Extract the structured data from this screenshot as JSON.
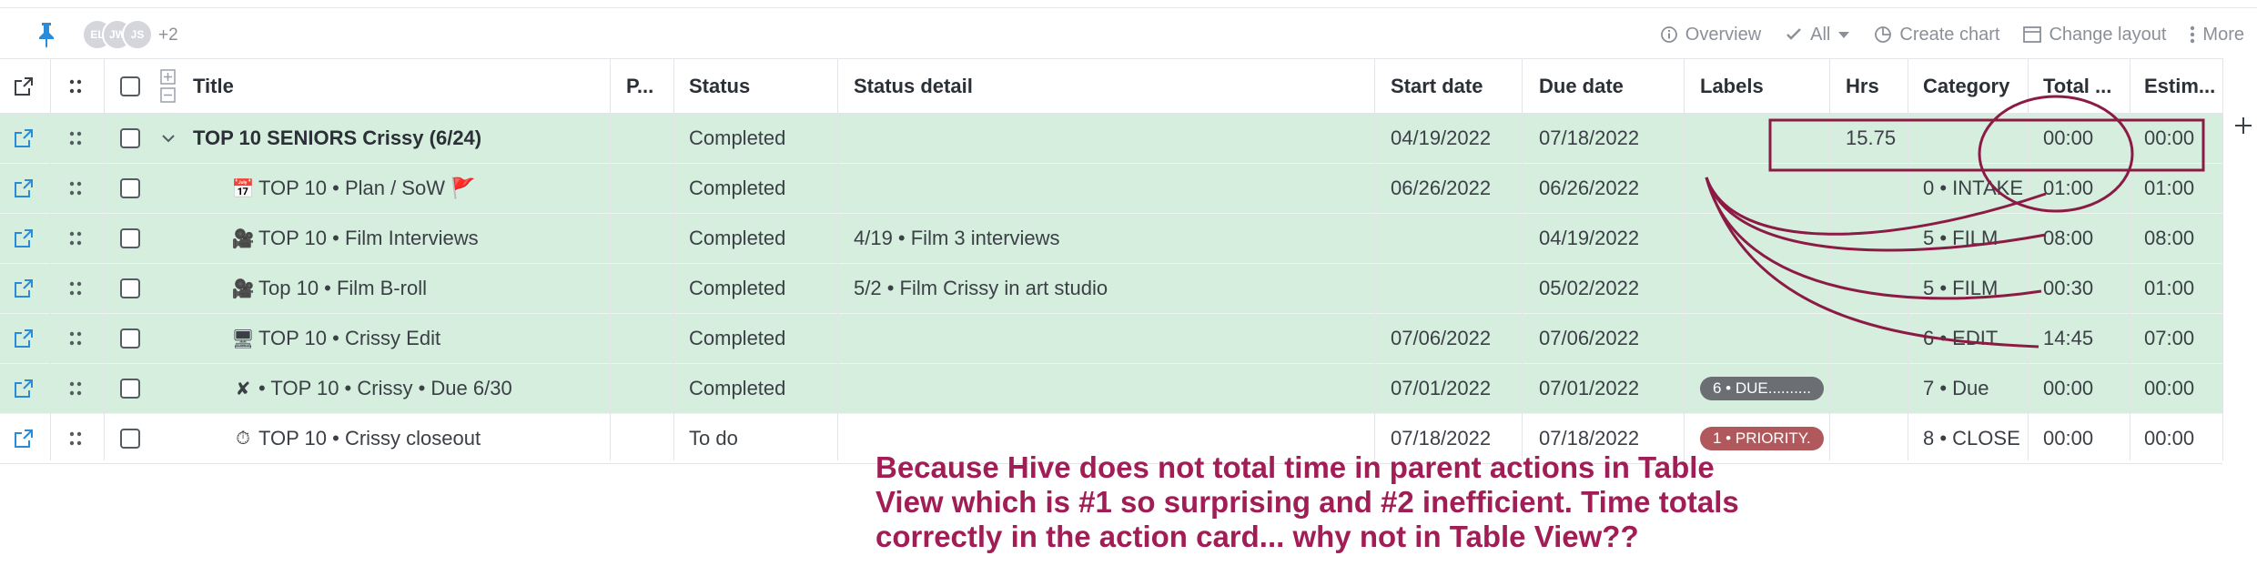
{
  "toolbar": {
    "avatars": [
      "EL",
      "JW",
      "JS"
    ],
    "avatar_more": "+2",
    "overview_label": "Overview",
    "filter_label": "All",
    "create_chart_label": "Create chart",
    "change_layout_label": "Change layout",
    "more_label": "More"
  },
  "table": {
    "columns": {
      "title": "Title",
      "p": "P...",
      "status": "Status",
      "status_detail": "Status detail",
      "start_date": "Start date",
      "due_date": "Due date",
      "labels": "Labels",
      "hrs": "Hrs",
      "category": "Category",
      "total": "Total ...",
      "estimate": "Estim..."
    },
    "rows": [
      {
        "title": "TOP 10 SENIORS Crissy (6/24)",
        "emoji": "",
        "status": "Completed",
        "status_detail": "",
        "start_date": "04/19/2022",
        "due_date": "07/18/2022",
        "label": "",
        "hrs": "15.75 h",
        "category": "",
        "total": "00:00",
        "estimate": "00:00"
      },
      {
        "title": "TOP 10 • Plan / SoW 🚩",
        "emoji": "📅",
        "status": "Completed",
        "status_detail": "",
        "start_date": "06/26/2022",
        "due_date": "06/26/2022",
        "label": "",
        "hrs": "",
        "category": "0 • INTAKE",
        "total": "01:00",
        "estimate": "01:00"
      },
      {
        "title": "TOP 10 • Film Interviews",
        "emoji": "🎥",
        "status": "Completed",
        "status_detail": "4/19 • Film 3 interviews",
        "start_date": "",
        "due_date": "04/19/2022",
        "label": "",
        "hrs": "",
        "category": "5 • FILM",
        "total": "08:00",
        "estimate": "08:00"
      },
      {
        "title": "Top 10 • Film B-roll",
        "emoji": "🎥",
        "status": "Completed",
        "status_detail": "5/2 • Film Crissy in art studio",
        "start_date": "",
        "due_date": "05/02/2022",
        "label": "",
        "hrs": "",
        "category": "5 • FILM",
        "total": "00:30",
        "estimate": "01:00"
      },
      {
        "title": "TOP 10 • Crissy Edit",
        "emoji": "🖥",
        "status": "Completed",
        "status_detail": "",
        "start_date": "07/06/2022",
        "due_date": "07/06/2022",
        "label": "",
        "hrs": "",
        "category": "6 • EDIT",
        "total": "14:45",
        "estimate": "07:00"
      },
      {
        "title": "• TOP 10 • Crissy • Due 6/30",
        "emoji": "✘",
        "status": "Completed",
        "status_detail": "",
        "start_date": "07/01/2022",
        "due_date": "07/01/2022",
        "label": "6 • DUE..........",
        "label_color": "#6b6e73",
        "hrs": "",
        "category": "7 • Due",
        "total": "00:00",
        "estimate": "00:00"
      },
      {
        "title": "TOP 10 • Crissy closeout",
        "emoji": "⏱",
        "status": "To do",
        "status_detail": "",
        "start_date": "07/18/2022",
        "due_date": "07/18/2022",
        "label": "1 • PRIORITY.",
        "label_color": "#b0585c",
        "hrs": "",
        "category": "8 • CLOSE",
        "total": "00:00",
        "estimate": "00:00"
      }
    ]
  },
  "annotation": {
    "text": "Because Hive does not total time in parent actions in Table\nView which is #1 so surprising and #2 inefficient.  Time totals\ncorrectly in the action card... why not in Table View??",
    "color": "#a01e55"
  },
  "colors": {
    "row_highlight": "#d5eede",
    "accent_blue": "#2a8bd8",
    "annotation_stroke": "#8b1b44"
  }
}
